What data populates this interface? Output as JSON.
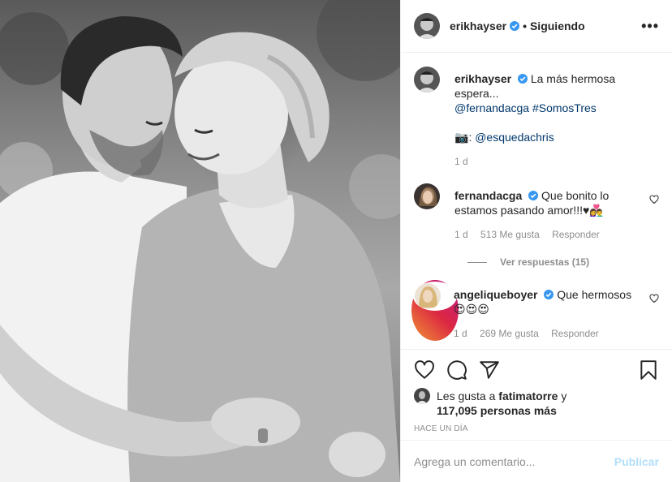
{
  "post": {
    "author": "erikhayser",
    "dot": "•",
    "follow_status": "Siguiendo",
    "more": "•••"
  },
  "caption": {
    "username": "erikhayser",
    "text": "La más hermosa espera...",
    "line2": "@fernandacga #SomosTres",
    "camera_emoji": "📷",
    "credit_sep": ":",
    "credit": "@esquedachris",
    "time": "1 d"
  },
  "comments": [
    {
      "username": "fernandacga",
      "text": "Que bonito lo estamos pasando amor!!!♥👩‍❤️‍👨",
      "time": "1 d",
      "likes": "513 Me gusta",
      "reply": "Responder",
      "view_replies": "Ver respuestas (15)"
    },
    {
      "username": "angeliqueboyer",
      "text": "Que hermosos",
      "emojis": "😍😍😍",
      "time": "1 d",
      "likes": "269 Me gusta",
      "reply": "Responder"
    }
  ],
  "likes": {
    "prefix": "Les gusta a",
    "user": "fatimatorre",
    "mid": "y",
    "count": "117,095 personas más"
  },
  "timestamp": "HACE UN DÍA",
  "add_comment": {
    "placeholder": "Agrega un comentario...",
    "publish": "Publicar"
  },
  "colors": {
    "link": "#00376b",
    "verified": "#3897f0",
    "muted": "#8e8e8e",
    "publish_disabled": "#b2dffc"
  },
  "icons": [
    "heart-icon",
    "comment-icon",
    "share-icon",
    "bookmark-icon",
    "verified-icon",
    "more-options-icon"
  ]
}
